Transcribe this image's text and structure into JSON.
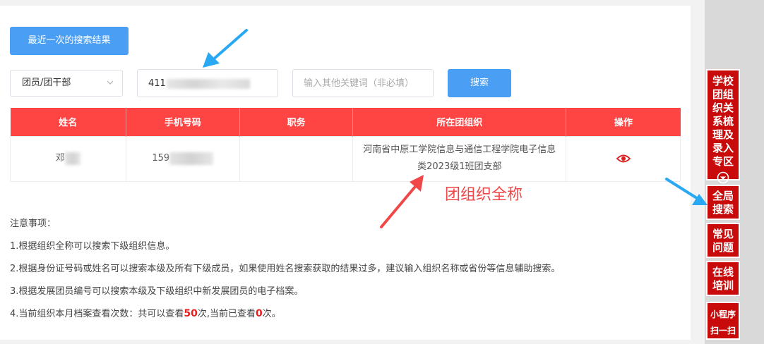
{
  "recent_button": "最近一次的搜索结果",
  "search": {
    "type_select": "团员/团干部",
    "id_value": "411",
    "keyword_placeholder": "输入其他关键词（非必填）",
    "search_button": "搜索"
  },
  "table": {
    "headers": [
      "姓名",
      "手机号码",
      "职务",
      "所在团组织",
      "操作"
    ],
    "rows": [
      {
        "name": "邓",
        "phone": "159",
        "position": "",
        "org": "河南省中原工学院信息与通信工程学院电子信息类2023级1班团支部"
      }
    ]
  },
  "annotation": "团组织全称",
  "notes": {
    "title": "注意事项：",
    "items": [
      "1.根据组织全称可以搜索下级组织信息。",
      "2.根据身份证号码或姓名可以搜索本级及所有下级成员，如果使用姓名搜索获取的结果过多，建议输入组织名称或省份等信息辅助搜索。",
      "3.根据发展团员编号可以搜索本级及下级组织中新发展团员的电子档案。"
    ],
    "item4_prefix": "4.当前组织本月档案查看次数：共可以查看",
    "item4_total": "50",
    "item4_mid": "次,当前已查看",
    "item4_used": "0",
    "item4_suffix": "次。"
  },
  "sidebar": {
    "school_review": "学校团组织关系梳理及录入专区",
    "global_search": "全局搜索",
    "faq": "常见问题",
    "online_training": "在线培训",
    "mini_program_line1": "小程序",
    "mini_program_line2": "扫一扫"
  },
  "colors": {
    "primary": "#4a9ff5",
    "header_red": "#ff4444",
    "side_red": "#c90a0a",
    "arrow_blue": "#29a8f4",
    "arrow_red": "#f04848"
  }
}
